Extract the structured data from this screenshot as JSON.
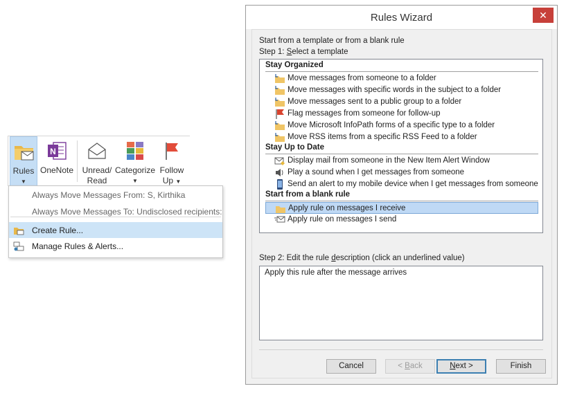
{
  "ribbon": {
    "rules": {
      "label": "Rules",
      "icon": "folder-envelope-icon"
    },
    "onenote": {
      "label": "OneNote",
      "icon": "onenote-icon"
    },
    "unread": {
      "label1": "Unread/",
      "label2": "Read",
      "icon": "open-envelope-icon"
    },
    "categorize": {
      "label": "Categorize",
      "icon": "category-grid-icon"
    },
    "followup": {
      "label1": "Follow",
      "label2": "Up",
      "icon": "flag-icon"
    }
  },
  "menu": {
    "items": [
      {
        "label": "Always Move Messages From: S, Kirthika",
        "disabled": true
      },
      {
        "label": "Always Move Messages To: Undisclosed recipients:",
        "disabled": true
      },
      {
        "label": "Create Rule...",
        "selected": true,
        "icon": "create-rule-icon"
      },
      {
        "label": "Manage Rules & Alerts...",
        "icon": "manage-rules-icon"
      }
    ]
  },
  "dialog": {
    "title": "Rules Wizard",
    "intro": "Start from a template or from a blank rule",
    "step1_pre": "Step 1: ",
    "step1_key": "S",
    "step1_post": "elect a template",
    "sections": [
      {
        "title": "Stay Organized",
        "items": [
          {
            "label": "Move messages from someone to a folder",
            "icon": "move-to-folder-icon"
          },
          {
            "label": "Move messages with specific words in the subject to a folder",
            "icon": "move-to-folder-icon"
          },
          {
            "label": "Move messages sent to a public group to a folder",
            "icon": "move-to-folder-icon"
          },
          {
            "label": "Flag messages from someone for follow-up",
            "icon": "flag-icon"
          },
          {
            "label": "Move Microsoft InfoPath forms of a specific type to a folder",
            "icon": "move-to-folder-icon"
          },
          {
            "label": "Move RSS items from a specific RSS Feed to a folder",
            "icon": "move-to-folder-icon"
          }
        ]
      },
      {
        "title": "Stay Up to Date",
        "items": [
          {
            "label": "Display mail from someone in the New Item Alert Window",
            "icon": "alert-envelope-icon"
          },
          {
            "label": "Play a sound when I get messages from someone",
            "icon": "speaker-icon"
          },
          {
            "label": "Send an alert to my mobile device when I get messages from someone",
            "icon": "mobile-device-icon"
          }
        ]
      },
      {
        "title": "Start from a blank rule",
        "items": [
          {
            "label": "Apply rule on messages I receive",
            "icon": "receive-envelope-icon",
            "selected": true
          },
          {
            "label": "Apply rule on messages I send",
            "icon": "send-envelope-icon"
          }
        ]
      }
    ],
    "step2_pre": "Step 2: Edit the rule ",
    "step2_key": "d",
    "step2_post": "escription (click an underlined value)",
    "description": "Apply this rule after the message arrives",
    "buttons": {
      "cancel": "Cancel",
      "back_pre": "< ",
      "back_key": "B",
      "back_post": "ack",
      "next_key": "N",
      "next_post": "ext >",
      "finish": "Finish"
    },
    "close_glyph": "✕"
  }
}
